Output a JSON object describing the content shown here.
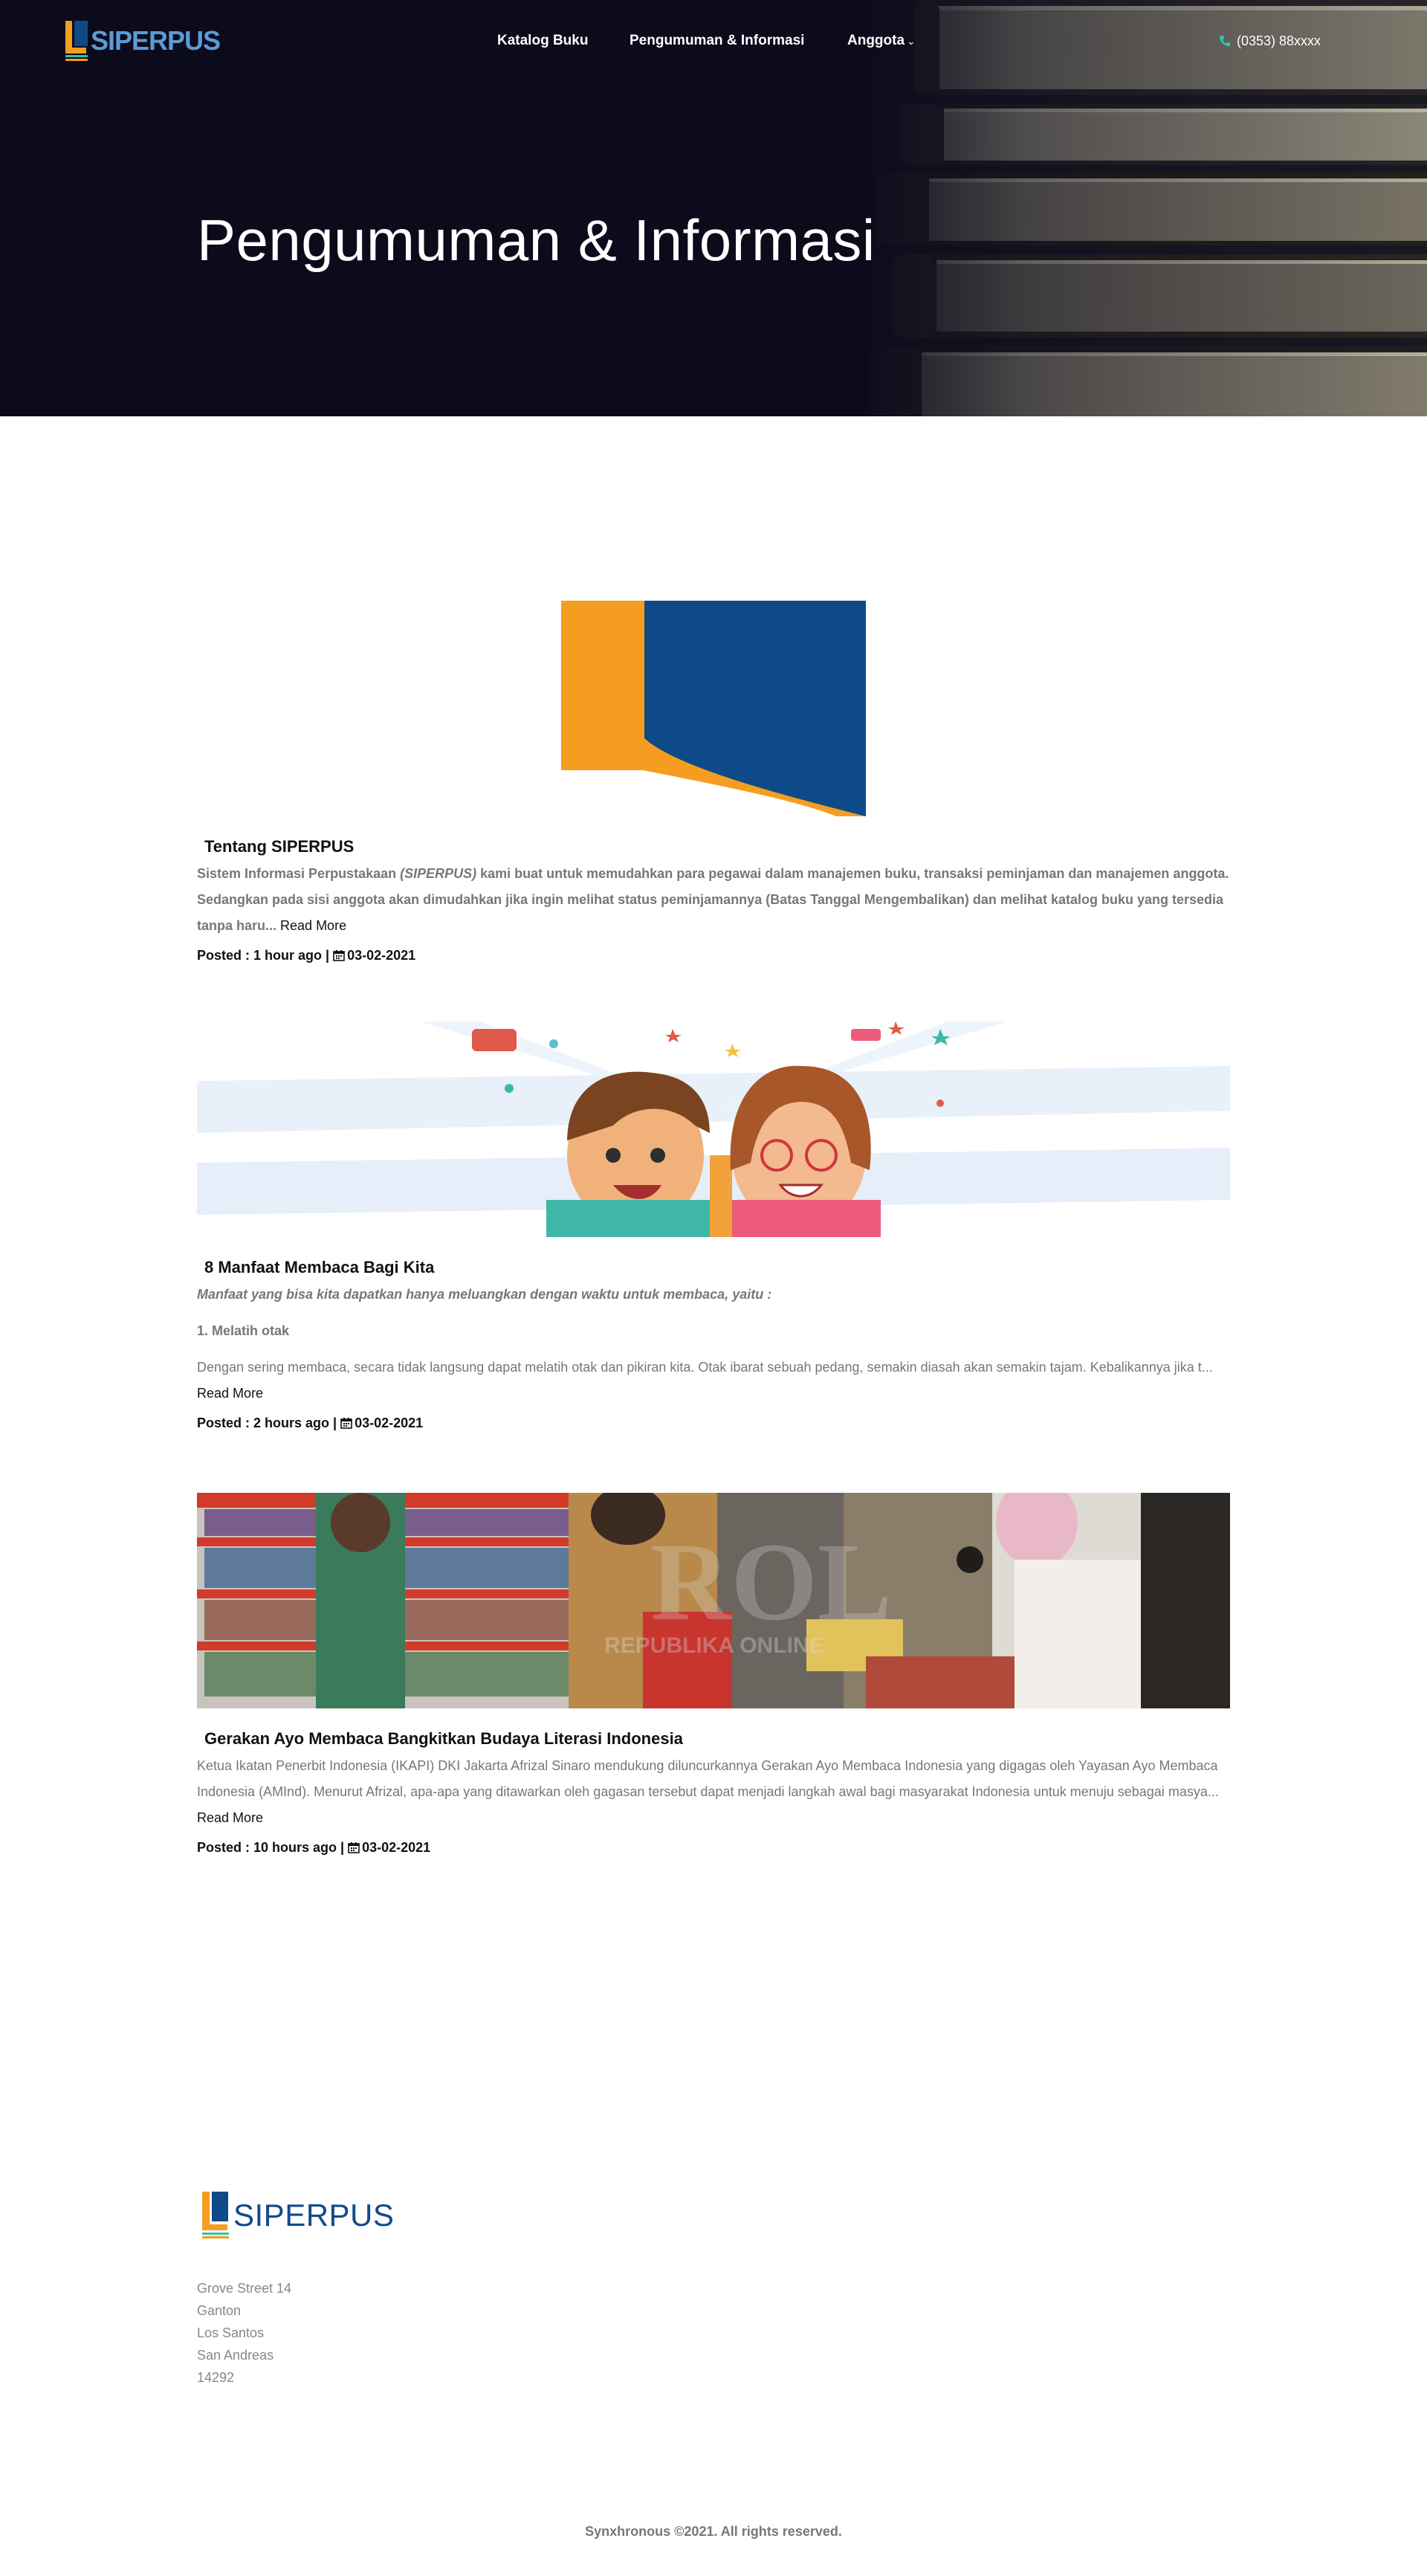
{
  "brand": {
    "name": "SIPERPUS"
  },
  "nav": {
    "items": [
      {
        "label": "Katalog Buku"
      },
      {
        "label": "Pengumuman & Informasi"
      },
      {
        "label": "Anggota"
      }
    ],
    "phone": "(0353) 88xxxx"
  },
  "hero": {
    "title": "Pengumuman & Informasi"
  },
  "posts": [
    {
      "title": "Tentang SIPERPUS",
      "body_a": "Sistem Informasi Perpustakaan ",
      "body_b": "(SIPERPUS)",
      "body_c": " kami buat untuk memudahkan para pegawai dalam manajemen buku, transaksi peminjaman dan manajemen anggota. Sedangkan pada sisi anggota akan dimudahkan jika ingin melihat status peminjamannya (Batas Tanggal Mengembalikan) dan melihat katalog buku yang tersedia tanpa haru...",
      "read_more": "Read More",
      "posted": "Posted : 1 hour ago |",
      "date": "03-02-2021"
    },
    {
      "title": "8 Manfaat Membaca Bagi Kita",
      "intro": "Manfaat yang bisa kita dapatkan hanya meluangkan dengan waktu untuk membaca, yaitu :",
      "point": "1. Melatih otak",
      "body": "Dengan sering membaca, secara tidak langsung dapat melatih otak dan pikiran kita. Otak ibarat sebuah pedang, semakin diasah akan semakin tajam. Kebalikannya jika t...",
      "read_more": "Read More",
      "posted": "Posted : 2 hours ago |",
      "date": "03-02-2021"
    },
    {
      "title": "Gerakan Ayo Membaca Bangkitkan Budaya Literasi Indonesia",
      "body": "Ketua Ikatan Penerbit Indonesia (IKAPI) DKI Jakarta Afrizal Sinaro mendukung diluncurkannya Gerakan  Ayo Membaca Indonesia yang digagas oleh Yayasan Ayo Membaca Indonesia (AMInd). Menurut Afrizal, apa-apa yang ditawarkan oleh gagasan tersebut dapat menjadi langkah awal bagi masyarakat Indonesia untuk menuju sebagai masya...",
      "read_more": "Read More",
      "posted": "Posted : 10 hours ago |",
      "date": "03-02-2021",
      "watermark": "ROL",
      "watermark_sub": "REPUBLIKA ONLINE"
    }
  ],
  "footer": {
    "address": [
      "Grove Street 14",
      "Ganton",
      "Los Santos",
      "San Andreas",
      "14292"
    ],
    "copyright": "Synxhronous ©2021. All rights reserved."
  },
  "colors": {
    "hero_bg": "#0b0b1c",
    "logo_orange": "#f59d20",
    "logo_blue": "#0e4a88",
    "phone_icon": "#2fc4b2"
  },
  "icons": [
    "phone-icon",
    "calendar-icon",
    "chevron-down-icon"
  ]
}
